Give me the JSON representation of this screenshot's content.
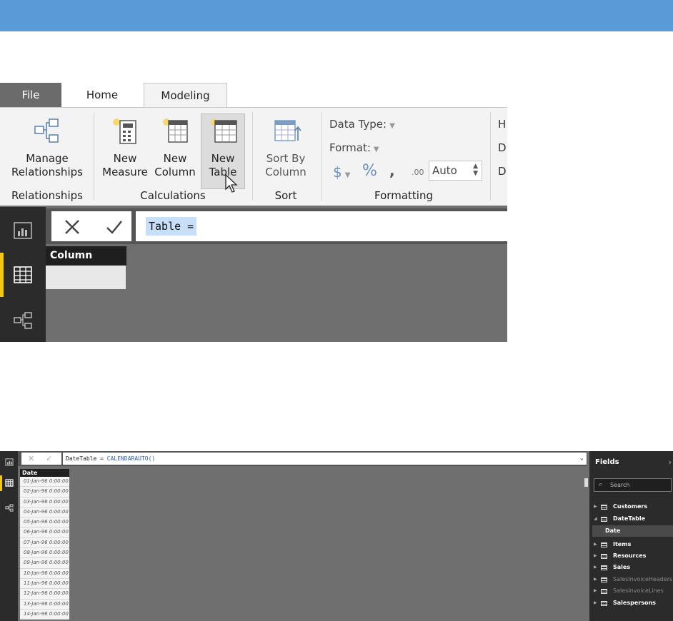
{
  "shot1": {
    "tabs": [
      "File",
      "Home",
      "Modeling"
    ],
    "ribbon": {
      "manage_relationships": "Manage\nRelationships",
      "new_measure": "New\nMeasure",
      "new_column": "New\nColumn",
      "new_table": "New\nTable",
      "sort_by_column": "Sort By\nColumn",
      "data_type": "Data Type:",
      "format": "Format:",
      "currency": "$",
      "percent": "%",
      "comma": ",",
      "decimals": ".00",
      "auto": "Auto",
      "truncated": [
        "H",
        "D",
        "D"
      ],
      "groups": [
        "Relationships",
        "Calculations",
        "Sort",
        "Formatting"
      ]
    },
    "formula": "Table =",
    "column_header": "Column"
  },
  "shot2": {
    "formula_prefix": "DateTable = ",
    "formula_fn": "CALENDARAUTO()",
    "column_header": "Date",
    "dates": [
      "01-Jan-96 0:00:00",
      "02-Jan-96 0:00:00",
      "03-Jan-96 0:00:00",
      "04-Jan-96 0:00:00",
      "05-Jan-96 0:00:00",
      "06-Jan-96 0:00:00",
      "07-Jan-96 0:00:00",
      "08-Jan-96 0:00:00",
      "09-Jan-96 0:00:00",
      "10-Jan-96 0:00:00",
      "11-Jan-96 0:00:00",
      "12-Jan-96 0:00:00",
      "13-Jan-96 0:00:00",
      "14-Jan-96 0:00:00"
    ],
    "fields_panel": {
      "title": "Fields",
      "search_placeholder": "Search",
      "tables": [
        {
          "name": "Customers",
          "expanded": false,
          "dim": false
        },
        {
          "name": "DateTable",
          "expanded": true,
          "dim": false,
          "fields": [
            "Date"
          ]
        },
        {
          "name": "Items",
          "expanded": false,
          "dim": false
        },
        {
          "name": "Resources",
          "expanded": false,
          "dim": false
        },
        {
          "name": "Sales",
          "expanded": false,
          "dim": false
        },
        {
          "name": "SalesInvoiceHeaders",
          "expanded": false,
          "dim": true
        },
        {
          "name": "SalesInvoiceLines",
          "expanded": false,
          "dim": true
        },
        {
          "name": "Salespersons",
          "expanded": false,
          "dim": false
        }
      ]
    }
  },
  "colors": {
    "banner": "#5b9bd5",
    "accent": "#f2c811",
    "selection": "#c8e0f7"
  }
}
